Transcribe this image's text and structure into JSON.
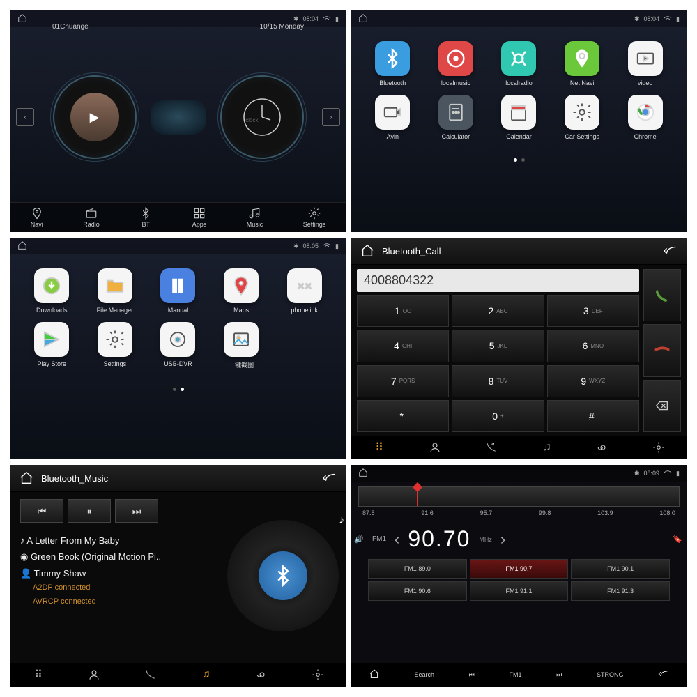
{
  "panel1": {
    "time": "08:04",
    "track": "01Chuange",
    "date": "10/15 Monday",
    "clock_label": "clock",
    "nav": [
      {
        "label": "Navi"
      },
      {
        "label": "Radio"
      },
      {
        "label": "BT"
      },
      {
        "label": "Apps"
      },
      {
        "label": "Music"
      },
      {
        "label": "Settings"
      }
    ]
  },
  "panel2": {
    "time": "08:04",
    "apps": [
      {
        "label": "Bluetooth",
        "bg": "#3a9de0",
        "glyph": "bt"
      },
      {
        "label": "localmusic",
        "bg": "#e04848",
        "glyph": "disc"
      },
      {
        "label": "localradio",
        "bg": "#30c8b0",
        "glyph": "radio"
      },
      {
        "label": "Net Navi",
        "bg": "#6ac83a",
        "glyph": "pin"
      },
      {
        "label": "video",
        "bg": "#f5f5f5",
        "glyph": "video"
      },
      {
        "label": "Avin",
        "bg": "#f5f5f5",
        "glyph": "cam"
      },
      {
        "label": "Calculator",
        "bg": "#4a5560",
        "glyph": "calc"
      },
      {
        "label": "Calendar",
        "bg": "#f5f5f5",
        "glyph": "cal"
      },
      {
        "label": "Car Settings",
        "bg": "#f5f5f5",
        "glyph": "gear"
      },
      {
        "label": "Chrome",
        "bg": "#f5f5f5",
        "glyph": "chrome"
      }
    ]
  },
  "panel3": {
    "time": "08:05",
    "apps": [
      {
        "label": "Downloads",
        "bg": "#f5f5f5",
        "glyph": "dl"
      },
      {
        "label": "File Manager",
        "bg": "#f5f5f5",
        "glyph": "folder"
      },
      {
        "label": "Manual",
        "bg": "#4a80e0",
        "glyph": "book"
      },
      {
        "label": "Maps",
        "bg": "#f5f5f5",
        "glyph": "maps"
      },
      {
        "label": "phonelink",
        "bg": "#f5f5f5",
        "glyph": "link"
      },
      {
        "label": "Play Store",
        "bg": "#f5f5f5",
        "glyph": "play"
      },
      {
        "label": "Settings",
        "bg": "#f5f5f5",
        "glyph": "gear"
      },
      {
        "label": "USB-DVR",
        "bg": "#f5f5f5",
        "glyph": "dvr"
      },
      {
        "label": "一键截图",
        "bg": "#f5f5f5",
        "glyph": "pic"
      }
    ]
  },
  "panel4": {
    "title": "Bluetooth_Call",
    "number": "4008804322",
    "keys": [
      {
        "n": "1",
        "l": "OO"
      },
      {
        "n": "2",
        "l": "ABC"
      },
      {
        "n": "3",
        "l": "DEF"
      },
      {
        "n": "4",
        "l": "GHI"
      },
      {
        "n": "5",
        "l": "JKL"
      },
      {
        "n": "6",
        "l": "MNO"
      },
      {
        "n": "7",
        "l": "PQRS"
      },
      {
        "n": "8",
        "l": "TUV"
      },
      {
        "n": "9",
        "l": "WXYZ"
      },
      {
        "n": "*",
        "l": ""
      },
      {
        "n": "0",
        "l": "+"
      },
      {
        "n": "#",
        "l": ""
      }
    ]
  },
  "panel5": {
    "title": "Bluetooth_Music",
    "song": "A Letter From My Baby",
    "album": "Green Book (Original Motion Pi..",
    "artist": "Timmy Shaw",
    "status1": "A2DP connected",
    "status2": "AVRCP connected"
  },
  "panel6": {
    "time": "08:09",
    "ticks": [
      "87.5",
      "91.6",
      "95.7",
      "99.8",
      "103.9",
      "108.0"
    ],
    "band": "FM1",
    "freq": "90.70",
    "unit": "MHz",
    "presets": [
      {
        "label": "FM1 89.0"
      },
      {
        "label": "FM1 90.7",
        "active": true
      },
      {
        "label": "FM1 90.1"
      },
      {
        "label": "FM1 90.6"
      },
      {
        "label": "FM1 91.1"
      },
      {
        "label": "FM1 91.3"
      }
    ],
    "bar": [
      "Search",
      "FM1",
      "STRONG"
    ]
  }
}
